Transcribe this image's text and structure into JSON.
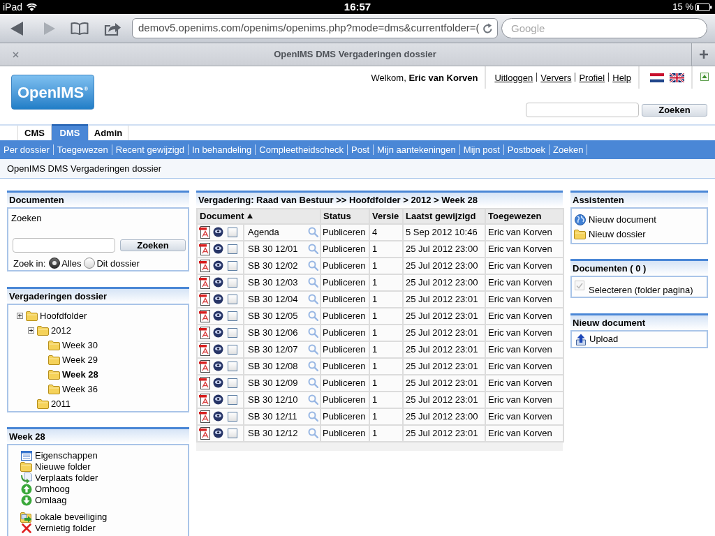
{
  "status_bar": {
    "device": "iPad",
    "time": "16:57",
    "battery": "15 %"
  },
  "browser": {
    "forward_disabled": true,
    "url": "demov5.openims.com/openims/openims.php?mode=dms&currentfolder=(",
    "search_placeholder": "Google",
    "tab_title": "OpenIMS DMS Vergaderingen dossier"
  },
  "header": {
    "logo": "OpenIMS$^{®}$",
    "welcome": "Welkom, **Eric van Korven**",
    "links": [
      "Uitloggen",
      "Ververs",
      "Profiel",
      "Help"
    ],
    "search_button": "Zoeken"
  },
  "tabs": [
    {
      "label": "CMS",
      "selected": false
    },
    {
      "label": "DMS",
      "selected": true
    },
    {
      "label": "Admin",
      "selected": false
    }
  ],
  "nav_links": [
    "Per dossier",
    "Toegewezen",
    "Recent gewijzigd",
    "In behandeling",
    "Compleetheidscheck",
    "Post",
    "Mijn aantekeningen",
    "Mijn post",
    "Postboek",
    "Zoeken"
  ],
  "breadcrumb": "OpenIMS DMS Vergaderingen dossier",
  "document_search": {
    "title": "Documenten",
    "label": "Zoeken",
    "button": "Zoeken",
    "scope_label": "Zoek in:",
    "options": [
      {
        "label": "Alles",
        "selected": true
      },
      {
        "label": "Dit dossier",
        "selected": false
      }
    ]
  },
  "folder_tree": {
    "title": "Vergaderingen dossier",
    "items": [
      {
        "label": "Hoofdfolder",
        "toggle": true,
        "selected": false,
        "children": [
          {
            "label": "2012",
            "toggle": true,
            "selected": false,
            "children": [
              {
                "label": "Week 30",
                "toggle": false,
                "selected": false
              },
              {
                "label": "Week 29",
                "toggle": false,
                "selected": false
              },
              {
                "label": "Week 28",
                "toggle": false,
                "selected": true
              },
              {
                "label": "Week 36",
                "toggle": false,
                "selected": false
              }
            ]
          },
          {
            "label": "2011",
            "toggle": false,
            "selected": false
          }
        ]
      }
    ]
  },
  "folder_actions": {
    "title": "Week 28",
    "groups": [
      {
        "actions": [
          {
            "kind": "properties",
            "label": "Eigenschappen"
          },
          {
            "kind": "new_folder",
            "label": "Nieuwe folder"
          },
          {
            "kind": "move",
            "label": "Verplaats folder"
          },
          {
            "kind": "up",
            "label": "Omhoog"
          },
          {
            "kind": "down",
            "label": "Omlaag"
          }
        ]
      },
      {
        "actions": [
          {
            "kind": "security",
            "label": "Lokale beveiliging"
          },
          {
            "kind": "delete",
            "label": "Vernietig folder"
          }
        ]
      }
    ]
  },
  "documents": {
    "title": "Vergadering: Raad van Bestuur >> Hoofdfolder > 2012 > Week 28",
    "columns": [
      {
        "label": "Document",
        "sorted": true
      },
      {
        "label": "Status",
        "sorted": false
      },
      {
        "label": "Versie",
        "sorted": false
      },
      {
        "label": "Laatst gewijzigd",
        "sorted": false
      },
      {
        "label": "Toegewezen",
        "sorted": false
      }
    ],
    "rows": [
      {
        "name": "Agenda",
        "checked": false,
        "status": "Publiceren",
        "version": "4",
        "modified": "5 Sep 2012 10:46",
        "assigned": "Eric van Korven"
      },
      {
        "name": "SB 30 12/01",
        "checked": false,
        "status": "Publiceren",
        "version": "1",
        "modified": "25 Jul 2012 23:00",
        "assigned": "Eric van Korven"
      },
      {
        "name": "SB 30 12/02",
        "checked": false,
        "status": "Publiceren",
        "version": "1",
        "modified": "25 Jul 2012 23:00",
        "assigned": "Eric van Korven"
      },
      {
        "name": "SB 30 12/03",
        "checked": false,
        "status": "Publiceren",
        "version": "1",
        "modified": "25 Jul 2012 23:00",
        "assigned": "Eric van Korven"
      },
      {
        "name": "SB 30 12/04",
        "checked": false,
        "status": "Publiceren",
        "version": "1",
        "modified": "25 Jul 2012 23:01",
        "assigned": "Eric van Korven"
      },
      {
        "name": "SB 30 12/05",
        "checked": false,
        "status": "Publiceren",
        "version": "1",
        "modified": "25 Jul 2012 23:01",
        "assigned": "Eric van Korven"
      },
      {
        "name": "SB 30 12/06",
        "checked": false,
        "status": "Publiceren",
        "version": "1",
        "modified": "25 Jul 2012 23:01",
        "assigned": "Eric van Korven"
      },
      {
        "name": "SB 30 12/07",
        "checked": false,
        "status": "Publiceren",
        "version": "1",
        "modified": "25 Jul 2012 23:01",
        "assigned": "Eric van Korven"
      },
      {
        "name": "SB 30 12/08",
        "checked": false,
        "status": "Publiceren",
        "version": "1",
        "modified": "25 Jul 2012 23:01",
        "assigned": "Eric van Korven"
      },
      {
        "name": "SB 30 12/09",
        "checked": false,
        "status": "Publiceren",
        "version": "1",
        "modified": "25 Jul 2012 23:01",
        "assigned": "Eric van Korven"
      },
      {
        "name": "SB 30 12/10",
        "checked": false,
        "status": "Publiceren",
        "version": "1",
        "modified": "25 Jul 2012 23:01",
        "assigned": "Eric van Korven"
      },
      {
        "name": "SB 30 12/11",
        "checked": false,
        "status": "Publiceren",
        "version": "1",
        "modified": "25 Jul 2012 23:00",
        "assigned": "Eric van Korven"
      },
      {
        "name": "SB 30 12/12",
        "checked": false,
        "status": "Publiceren",
        "version": "1",
        "modified": "25 Jul 2012 23:01",
        "assigned": "Eric van Korven"
      }
    ]
  },
  "assistants": {
    "title": "Assistenten",
    "items": [
      {
        "kind": "globe",
        "label": "Nieuw document"
      },
      {
        "kind": "folder",
        "label": "Nieuw dossier"
      }
    ]
  },
  "selection": {
    "title": "Documenten ( 0 )",
    "label": "Selecteren (folder pagina)",
    "checked": true,
    "disabled": true
  },
  "new_document": {
    "title": "Nieuw document",
    "items": [
      {
        "kind": "upload",
        "label": "Upload"
      }
    ]
  }
}
